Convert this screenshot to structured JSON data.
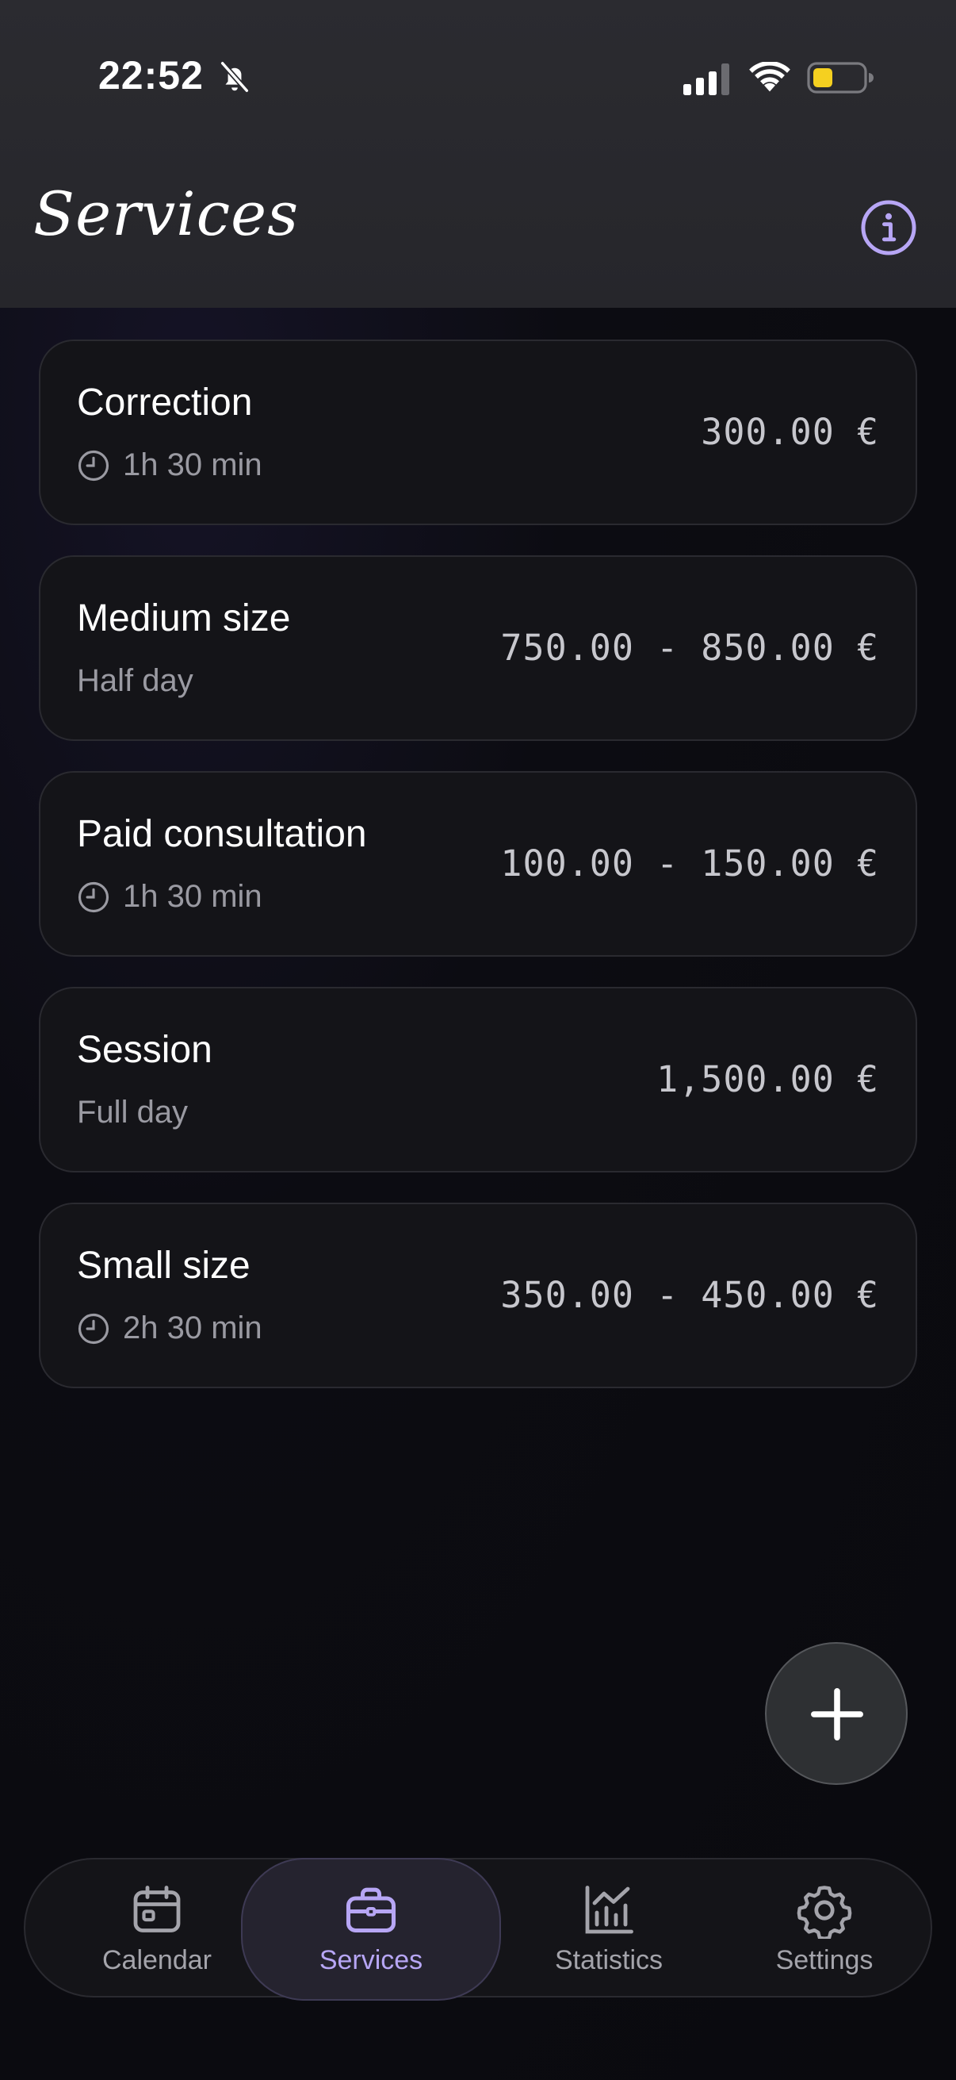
{
  "status_bar": {
    "time": "22:52"
  },
  "header": {
    "title": "Services"
  },
  "services": [
    {
      "name": "Correction",
      "duration": "1h 30 min",
      "has_clock": true,
      "price": "300.00 €"
    },
    {
      "name": "Medium size",
      "duration": "Half day",
      "has_clock": false,
      "price": "750.00 - 850.00 €"
    },
    {
      "name": "Paid consultation",
      "duration": "1h 30 min",
      "has_clock": true,
      "price": "100.00 - 150.00 €"
    },
    {
      "name": "Session",
      "duration": "Full day",
      "has_clock": false,
      "price": "1,500.00 €"
    },
    {
      "name": "Small size",
      "duration": "2h 30 min",
      "has_clock": true,
      "price": "350.00 - 450.00 €"
    }
  ],
  "tabbar": {
    "active": "services",
    "tabs": [
      {
        "id": "calendar",
        "label": "Calendar",
        "icon": "calendar-icon"
      },
      {
        "id": "services",
        "label": "Services",
        "icon": "briefcase-icon"
      },
      {
        "id": "statistics",
        "label": "Statistics",
        "icon": "chart-icon"
      },
      {
        "id": "settings",
        "label": "Settings",
        "icon": "gear-icon"
      }
    ]
  },
  "colors": {
    "accent": "#b7a6f5",
    "battery": "#f5d020",
    "background": "#0b0b10",
    "card": "#141418"
  }
}
